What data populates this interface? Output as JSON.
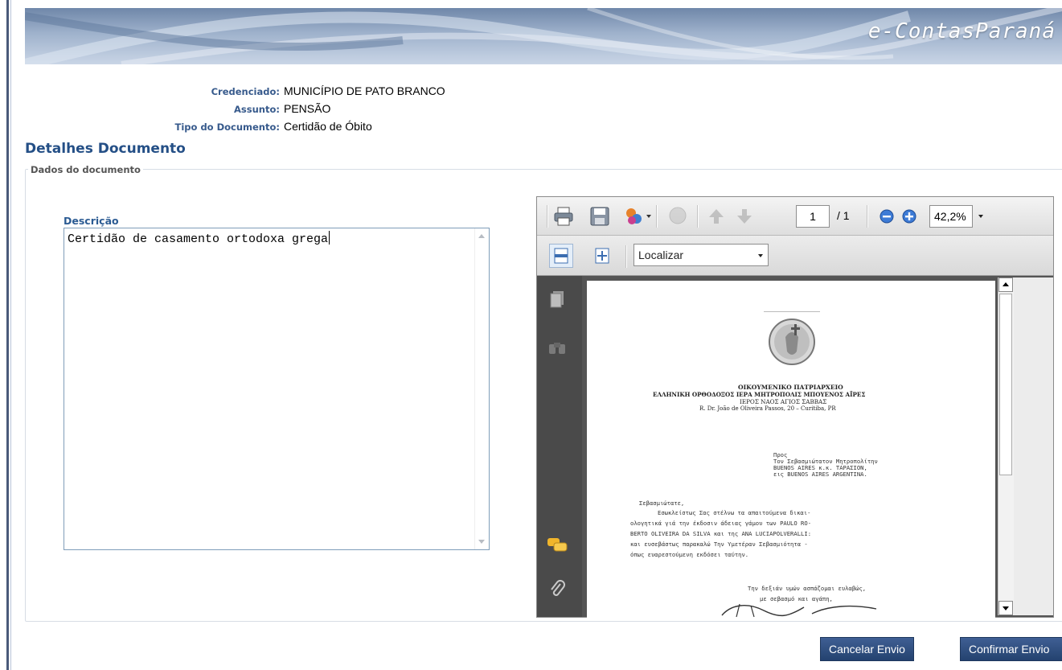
{
  "header": {
    "brand": "e-ContasParaná"
  },
  "meta": {
    "credenciado_label": "Credenciado:",
    "credenciado_value": "MUNICÍPIO DE PATO BRANCO",
    "assunto_label": "Assunto:",
    "assunto_value": "PENSÃO",
    "tipo_label": "Tipo do Documento:",
    "tipo_value": "Certidão de Óbito"
  },
  "section": {
    "title": "Detalhes Documento",
    "legend": "Dados do documento"
  },
  "descricao": {
    "label": "Descrição",
    "value": "Certidão de casamento ortodoxa grega"
  },
  "viewer": {
    "page_current": "1",
    "page_total": "/ 1",
    "zoom": "42,2%",
    "find_placeholder": "Localizar",
    "icons": {
      "print": "print-icon",
      "save": "save-icon",
      "share": "share-icon",
      "comment": "comment-icon",
      "prev_page": "arrow-up-icon",
      "next_page": "arrow-down-icon",
      "zoom_out": "zoom-out-icon",
      "zoom_in": "zoom-in-icon",
      "fit_width": "fit-width-icon",
      "fit_page": "fit-page-icon",
      "pages_panel": "pages-icon",
      "find_panel": "binoculars-icon",
      "comments_panel": "comments-icon",
      "attachments_panel": "paperclip-icon"
    },
    "document": {
      "heading_1": "ΟΙΚΟΥΜΕΝΙΚΟ ΠΑΤΡΙΑΡΧΕΙΟ",
      "heading_2": "ΕΛΛΗΝΙΚΗ ΟΡΘΟΔΟΞΟΣ ΙΕΡΑ ΜΗΤΡΟΠΟΛΙΣ ΜΠΟΥΕΝΟΣ ΑΪΡΕΣ",
      "heading_3": "ΙΕΡΟΣ ΝΑΟΣ ΑΓΙΟΣ ΣΑΒΒΑΣ",
      "address": "R. Dr. João de Oliveira Passos, 20 – Curitiba, PR",
      "recipient_1": "Προς",
      "recipient_2": "Τον Σεβασμιώτατον Μητροπολίτην",
      "recipient_3": "BUENOS AIRES κ.κ. ΤΑΡΑΣΙΟΝ,",
      "recipient_4": "εις BUENOS AIRES ARGENTINA.",
      "salutation": "Σεβασμιώτατε,",
      "body_1": "Εσωκλείστως Σας στέλνω τα απαιτούμενα δικαι-",
      "body_2": "ολογητικά γιά την έκδοσιν άδειας γάμου των PAULO RO-",
      "body_3": "BERTO OLIVEIRA DA SILVA και της ANA LUCIAPOLVERALLI:",
      "body_4": "και ευσεβάστως παρακαλώ Την Υμετέραν Σεβασμιότητα  -",
      "body_5": "όπως ευαρεστούμενη εκδόσει ταύτην.",
      "closing_1": "Την δεξιάν υμών ασπάζομαι ευλαβώς,",
      "closing_2": "με σεβασμό και αγάπη,"
    }
  },
  "actions": {
    "cancel": "Cancelar Envio",
    "confirm": "Confirmar Envio"
  }
}
